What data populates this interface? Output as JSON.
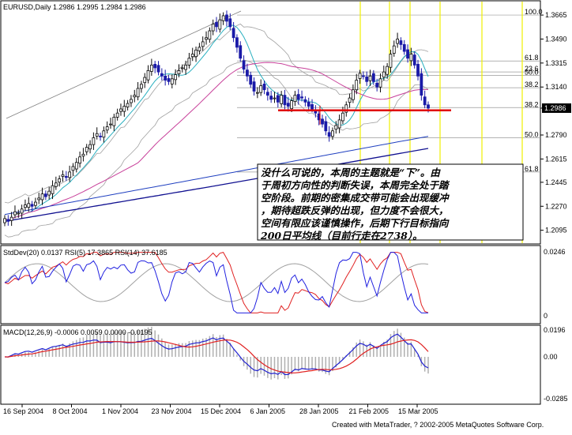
{
  "title": {
    "symbol_line": "EURUSD,Daily  1.2986 1.2995 1.2984 1.2986"
  },
  "footer": "Created with MetaTrader, ? 2002-2005 MetaQuotes Software Corp.",
  "annotation": {
    "lines": [
      "没什么可说的，本周的主题就是“下”。由",
      "于周初方向性的判断失误，本周完全处于踏",
      "空阶段。前期的密集成交带可能会出现缓冲",
      "，期待超跌反弹的出现，但力度不会很大，",
      "空间有限应该谨慎操作，后期下行目标指向",
      "200日平均线（目前行走在2738）。"
    ]
  },
  "colors": {
    "bull_candle": "#0a0a0a",
    "bear_candle": "#1a1aa8",
    "bollinger": "#a0a0a0",
    "ma_fast": "#2ab0c0",
    "ma_mid": "#c8409a",
    "ma_slow": "#2040c0",
    "ma_200": "#101090",
    "support_line": "#e00000",
    "fib_yellow": "#f0f000",
    "rsi_line": "#2020e0",
    "std_line": "#e02020",
    "macd_hist": "#b0b0b0",
    "macd_line": "#2020d0",
    "signal_line": "#e02020"
  },
  "chart_data": [
    {
      "type": "candlestick",
      "title": "EURUSD,Daily",
      "ohlc_last": {
        "open": 1.2986,
        "high": 1.2995,
        "low": 1.2984,
        "close": 1.2986
      },
      "x_tick_labels": [
        "16 Sep 2004",
        "8 Oct 2004",
        "1 Nov 2004",
        "23 Nov 2004",
        "15 Dec 2004",
        "6 Jan 2005",
        "28 Jan 2005",
        "21 Feb 2005",
        "15 Mar 2005"
      ],
      "y_tick_labels": [
        "1.3665",
        "1.3490",
        "1.3315",
        "1.3140",
        "1.2986",
        "1.2790",
        "1.2615",
        "1.2445",
        "1.2270",
        "1.2095"
      ],
      "ylim": [
        1.207,
        1.37
      ],
      "current_price_label": "1.2986",
      "fib_labels": [
        {
          "label": "100.0",
          "value": 1.3665
        },
        {
          "label": "61.8",
          "value": 1.333
        },
        {
          "label": "23.6",
          "value": 1.325
        },
        {
          "label": "50.0",
          "value": 1.3225
        },
        {
          "label": "38.2",
          "value": 1.3135
        },
        {
          "label": "38.2",
          "value": 1.299
        },
        {
          "label": "50.0",
          "value": 1.277
        },
        {
          "label": "61.8",
          "value": 1.252
        }
      ],
      "support_level": 1.297,
      "close_series": [
        1.218,
        1.216,
        1.219,
        1.223,
        1.222,
        1.225,
        1.228,
        1.229,
        1.227,
        1.23,
        1.233,
        1.236,
        1.234,
        1.238,
        1.242,
        1.244,
        1.247,
        1.25,
        1.248,
        1.252,
        1.256,
        1.259,
        1.263,
        1.265,
        1.27,
        1.272,
        1.277,
        1.28,
        1.278,
        1.282,
        1.285,
        1.287,
        1.292,
        1.295,
        1.298,
        1.3,
        1.302,
        1.305,
        1.308,
        1.313,
        1.316,
        1.321,
        1.326,
        1.33,
        1.328,
        1.325,
        1.322,
        1.319,
        1.318,
        1.32,
        1.323,
        1.326,
        1.328,
        1.33,
        1.335,
        1.338,
        1.341,
        1.343,
        1.347,
        1.35,
        1.355,
        1.36,
        1.358,
        1.363,
        1.366,
        1.362,
        1.358,
        1.35,
        1.343,
        1.335,
        1.327,
        1.322,
        1.316,
        1.311,
        1.31,
        1.315,
        1.312,
        1.308,
        1.305,
        1.306,
        1.303,
        1.308,
        1.301,
        1.3,
        1.304,
        1.308,
        1.305,
        1.306,
        1.303,
        1.3,
        1.298,
        1.295,
        1.29,
        1.287,
        1.282,
        1.278,
        1.282,
        1.286,
        1.29,
        1.295,
        1.301,
        1.306,
        1.312,
        1.319,
        1.324,
        1.322,
        1.318,
        1.322,
        1.318,
        1.314,
        1.32,
        1.325,
        1.329,
        1.338,
        1.344,
        1.349,
        1.345,
        1.34,
        1.335,
        1.338,
        1.33,
        1.322,
        1.308,
        1.301,
        1.2986
      ]
    },
    {
      "type": "line",
      "title": "StdDev(20) 0.0137  RSI(5) 17.3865  RSI(14) 37.6185",
      "y_tick_labels": [
        "0.0246",
        "0"
      ],
      "series": [
        {
          "name": "StdDev(20)",
          "last": 0.0137
        },
        {
          "name": "RSI(5)",
          "last": 17.3865
        },
        {
          "name": "RSI(14)",
          "last": 37.6185
        }
      ]
    },
    {
      "type": "bar",
      "title": "MACD(12,26,9) -0.0006 0.0059 0.0000 -0.0195",
      "y_tick_labels": [
        "0.0196",
        "0.00",
        "-0.0285"
      ],
      "values": [
        -0.0006,
        0.0059,
        0.0,
        -0.0195
      ]
    }
  ]
}
